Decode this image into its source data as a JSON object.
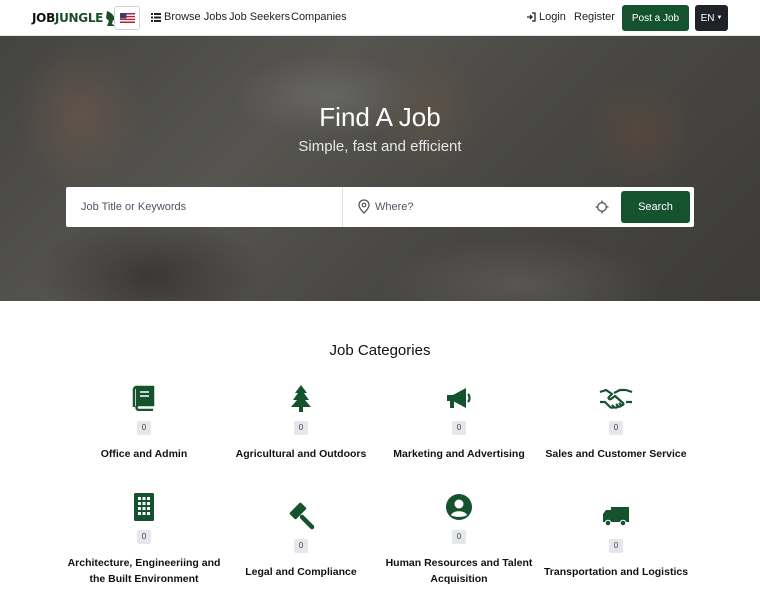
{
  "brand": {
    "logo_text_a": "JOB",
    "logo_text_b": "JUNGLE"
  },
  "nav": {
    "browse_jobs": "Browse Jobs",
    "job_seekers": "Job Seekers",
    "companies": "Companies",
    "login": "Login",
    "register": "Register",
    "post_job": "Post a Job",
    "language": "EN"
  },
  "hero": {
    "title": "Find A Job",
    "subtitle": "Simple, fast and efficient",
    "keyword_placeholder": "Job Title or Keywords",
    "where_placeholder": "Where?",
    "search_label": "Search"
  },
  "categories": {
    "title": "Job Categories",
    "items": [
      {
        "name": "Office and Admin",
        "count": "0",
        "icon": "book-icon"
      },
      {
        "name": "Agricultural and Outdoors",
        "count": "0",
        "icon": "tree-icon"
      },
      {
        "name": "Marketing and Advertising",
        "count": "0",
        "icon": "megaphone-icon"
      },
      {
        "name": "Sales and Customer Service",
        "count": "0",
        "icon": "handshake-icon"
      },
      {
        "name": "Architecture, Engineeriing and the Built Environment",
        "count": "0",
        "icon": "building-icon"
      },
      {
        "name": "Legal and Compliance",
        "count": "0",
        "icon": "gavel-icon"
      },
      {
        "name": "Human Resources and Talent Acquisition",
        "count": "0",
        "icon": "user-circle-icon"
      },
      {
        "name": "Transportation and Logistics",
        "count": "0",
        "icon": "truck-icon"
      }
    ]
  },
  "colors": {
    "brand_green": "#14532d",
    "dark_button": "#1f2227"
  }
}
